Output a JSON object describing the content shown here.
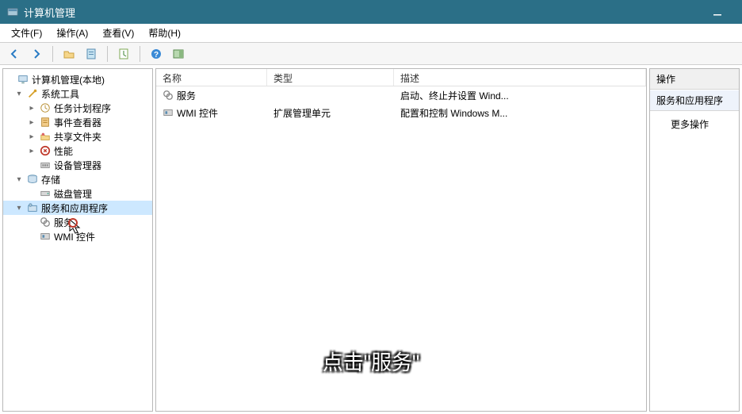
{
  "window": {
    "title": "计算机管理",
    "minimize_icon": "minimize-icon"
  },
  "menubar": {
    "items": [
      "文件(F)",
      "操作(A)",
      "查看(V)",
      "帮助(H)"
    ]
  },
  "toolbar": {
    "buttons": [
      {
        "name": "back-button",
        "icon": "arrow-left-icon"
      },
      {
        "name": "forward-button",
        "icon": "arrow-right-icon"
      },
      {
        "sep": true
      },
      {
        "name": "folder-up-button",
        "icon": "folder-icon"
      },
      {
        "name": "properties-button",
        "icon": "props-icon"
      },
      {
        "sep": true
      },
      {
        "name": "refresh-button",
        "icon": "refresh-icon"
      },
      {
        "sep": true
      },
      {
        "name": "help-button",
        "icon": "help-icon"
      },
      {
        "name": "show-hide-button",
        "icon": "panel-icon"
      }
    ]
  },
  "tree": {
    "root": {
      "label": "计算机管理(本地)",
      "icon": "computer-icon"
    },
    "groups": [
      {
        "label": "系统工具",
        "icon": "tools-icon",
        "expanded": true,
        "children": [
          {
            "label": "任务计划程序",
            "icon": "clock-icon",
            "expandable": true
          },
          {
            "label": "事件查看器",
            "icon": "event-icon",
            "expandable": true
          },
          {
            "label": "共享文件夹",
            "icon": "share-icon",
            "expandable": true
          },
          {
            "label": "性能",
            "icon": "perf-icon",
            "expandable": true
          },
          {
            "label": "设备管理器",
            "icon": "device-icon",
            "expandable": false
          }
        ]
      },
      {
        "label": "存储",
        "icon": "storage-icon",
        "expanded": true,
        "children": [
          {
            "label": "磁盘管理",
            "icon": "disk-icon",
            "expandable": false
          }
        ]
      },
      {
        "label": "服务和应用程序",
        "icon": "services-app-icon",
        "expanded": true,
        "selected": true,
        "children": [
          {
            "label": "服务",
            "icon": "service-icon",
            "expandable": false,
            "hover": true
          },
          {
            "label": "WMI 控件",
            "icon": "wmi-icon",
            "expandable": false
          }
        ]
      }
    ]
  },
  "list": {
    "columns": {
      "name": "名称",
      "type": "类型",
      "desc": "描述"
    },
    "rows": [
      {
        "name": "服务",
        "type": "",
        "desc": "启动、终止并设置 Wind...",
        "icon": "service-icon"
      },
      {
        "name": "WMI 控件",
        "type": "扩展管理单元",
        "desc": "配置和控制 Windows M...",
        "icon": "wmi-icon"
      }
    ]
  },
  "actions": {
    "header": "操作",
    "section": "服务和应用程序",
    "more": "更多操作"
  },
  "overlay": {
    "caption": "点击\"服务\""
  }
}
